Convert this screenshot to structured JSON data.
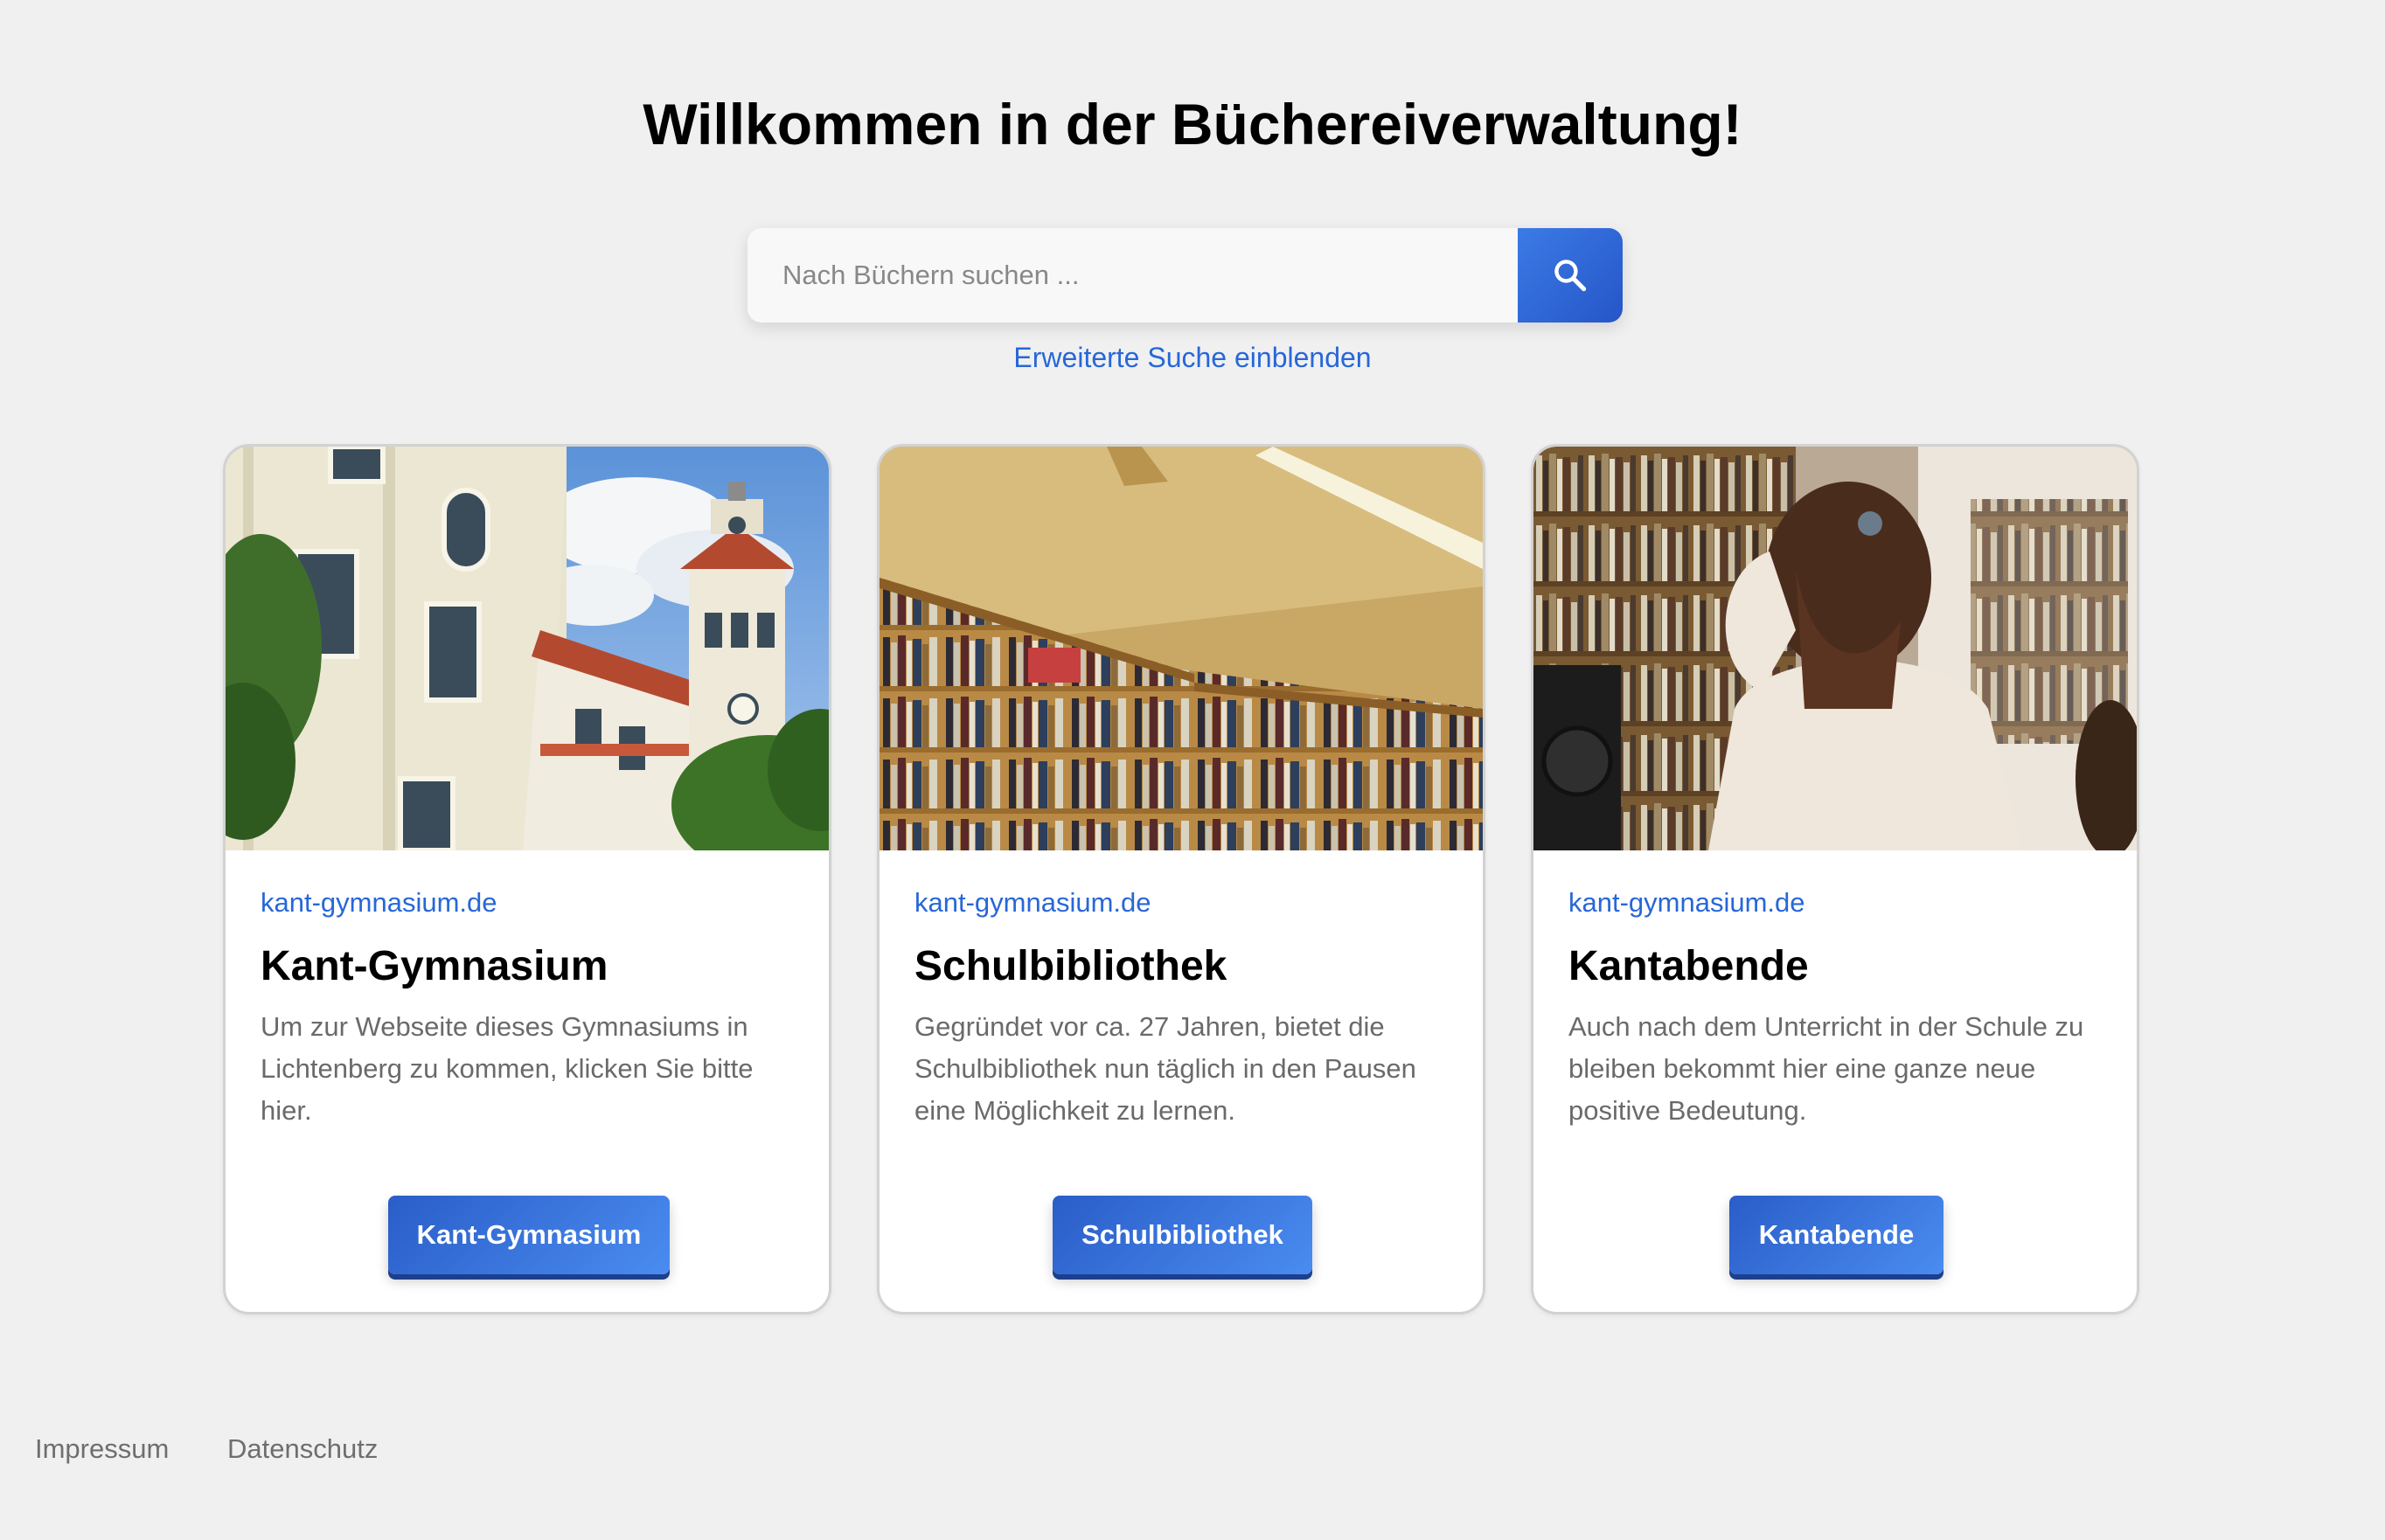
{
  "page": {
    "title": "Willkommen in der Büchereiverwaltung!"
  },
  "search": {
    "placeholder": "Nach Büchern suchen ...",
    "button_icon": "search-icon",
    "advanced_link": "Erweiterte Suche einblenden"
  },
  "cards": [
    {
      "source": "kant-gymnasium.de",
      "title": "Kant-Gymnasium",
      "text": "Um zur Webseite dieses Gymnasiums in Lichtenberg zu kommen, klicken Sie bitte hier.",
      "button_label": "Kant-Gymnasium",
      "image": "school-building-photo"
    },
    {
      "source": "kant-gymnasium.de",
      "title": "Schulbibliothek",
      "text": "Gegründet vor ca. 27 Jahren, bietet die Schulbibliothek nun täglich in den Pausen eine Möglichkeit zu lernen.",
      "button_label": "Schulbibliothek",
      "image": "library-bookshelves-photo"
    },
    {
      "source": "kant-gymnasium.de",
      "title": "Kantabende",
      "text": "Auch nach dem Unterricht in der Schule zu bleiben bekommt hier eine ganze neue positive Bedeutung.",
      "button_label": "Kantabende",
      "image": "student-in-library-photo"
    }
  ],
  "footer": {
    "links": [
      "Impressum",
      "Datenschutz"
    ]
  },
  "colors": {
    "background": "#f0f0f0",
    "accent": "#2767d8",
    "button_gradient_start": "#2a5dc8",
    "button_gradient_end": "#4a8cf0"
  }
}
